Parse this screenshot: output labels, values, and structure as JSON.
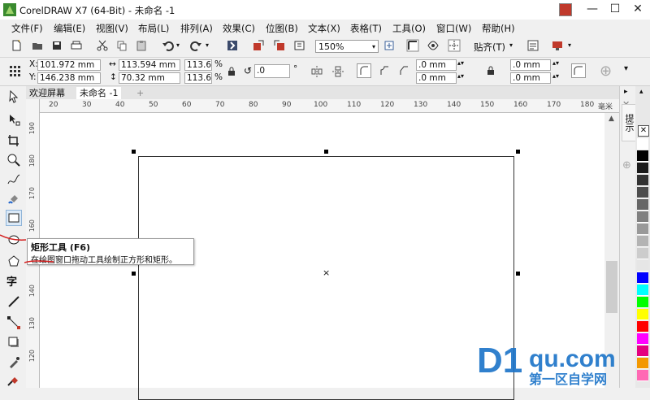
{
  "window": {
    "title": "CorelDRAW X7 (64-Bit) - 未命名 -1",
    "controls": {
      "minimize": "—",
      "restore": "☐",
      "close": "✕"
    }
  },
  "menu": [
    "文件(F)",
    "编辑(E)",
    "视图(V)",
    "布局(L)",
    "排列(A)",
    "效果(C)",
    "位图(B)",
    "文本(X)",
    "表格(T)",
    "工具(O)",
    "窗口(W)",
    "帮助(H)"
  ],
  "toolbar": {
    "zoom": "150%",
    "snap_label": "贴齐(T)"
  },
  "property_bar": {
    "x": "101.972 mm",
    "y": "146.238 mm",
    "width": "113.594 mm",
    "height": "70.32 mm",
    "scale_x": "113.6",
    "scale_y": "113.6",
    "percent": "%",
    "rotation": ".0",
    "degree": "°",
    "corner_tl": ".0 mm",
    "corner_bl": ".0 mm",
    "corner_tr": ".0 mm",
    "corner_br": ".0 mm"
  },
  "tabs": {
    "welcome": "欢迎屏幕",
    "document": "未命名 -1",
    "add": "+"
  },
  "ruler": {
    "unit": "毫米",
    "h_ticks": [
      "20",
      "30",
      "40",
      "50",
      "60",
      "70",
      "80",
      "90",
      "100",
      "110",
      "120",
      "130",
      "140",
      "150",
      "160",
      "170",
      "180"
    ],
    "v_ticks": [
      "190",
      "180",
      "170",
      "160",
      "150",
      "140",
      "130",
      "120"
    ]
  },
  "tooltip": {
    "title": "矩形工具 (F6)",
    "description": "在绘图窗口拖动工具绘制正方形和矩形。"
  },
  "docker": {
    "label": "提示"
  },
  "palette": [
    "#ffffff",
    "#000000",
    "#1a1a1a",
    "#333333",
    "#4d4d4d",
    "#666666",
    "#808080",
    "#999999",
    "#b3b3b3",
    "#cccccc",
    "#e6e6e6",
    "#0000ff",
    "#00ffff",
    "#00ff00",
    "#ffff00",
    "#ff0000",
    "#ff00ff",
    "#e4007f",
    "#f39800",
    "#ff69b4"
  ],
  "watermark": {
    "brand": "D1qu.com",
    "subtitle": "第一区自学网"
  }
}
